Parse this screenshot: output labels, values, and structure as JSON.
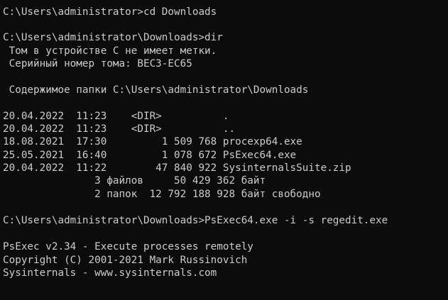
{
  "console": {
    "colors": {
      "background": "#0c0c0c",
      "foreground": "#cccccc"
    },
    "lines": [
      "C:\\Users\\administrator>cd Downloads",
      "",
      "C:\\Users\\administrator\\Downloads>dir",
      " Том в устройстве C не имеет метки.",
      " Серийный номер тома: BEC3-EC65",
      "",
      " Содержимое папки C:\\Users\\administrator\\Downloads",
      "",
      "20.04.2022  11:23    <DIR>          .",
      "20.04.2022  11:23    <DIR>          ..",
      "18.08.2021  17:30         1 509 768 procexp64.exe",
      "25.05.2021  16:40         1 078 672 PsExec64.exe",
      "20.04.2022  11:22        47 840 922 SysinternalsSuite.zip",
      "               3 файлов     50 429 362 байт",
      "               2 папок  12 792 188 928 байт свободно",
      "",
      "C:\\Users\\administrator\\Downloads>PsExec64.exe -i -s regedit.exe",
      "",
      "PsExec v2.34 - Execute processes remotely",
      "Copyright (C) 2001-2021 Mark Russinovich",
      "Sysinternals - www.sysinternals.com"
    ]
  }
}
